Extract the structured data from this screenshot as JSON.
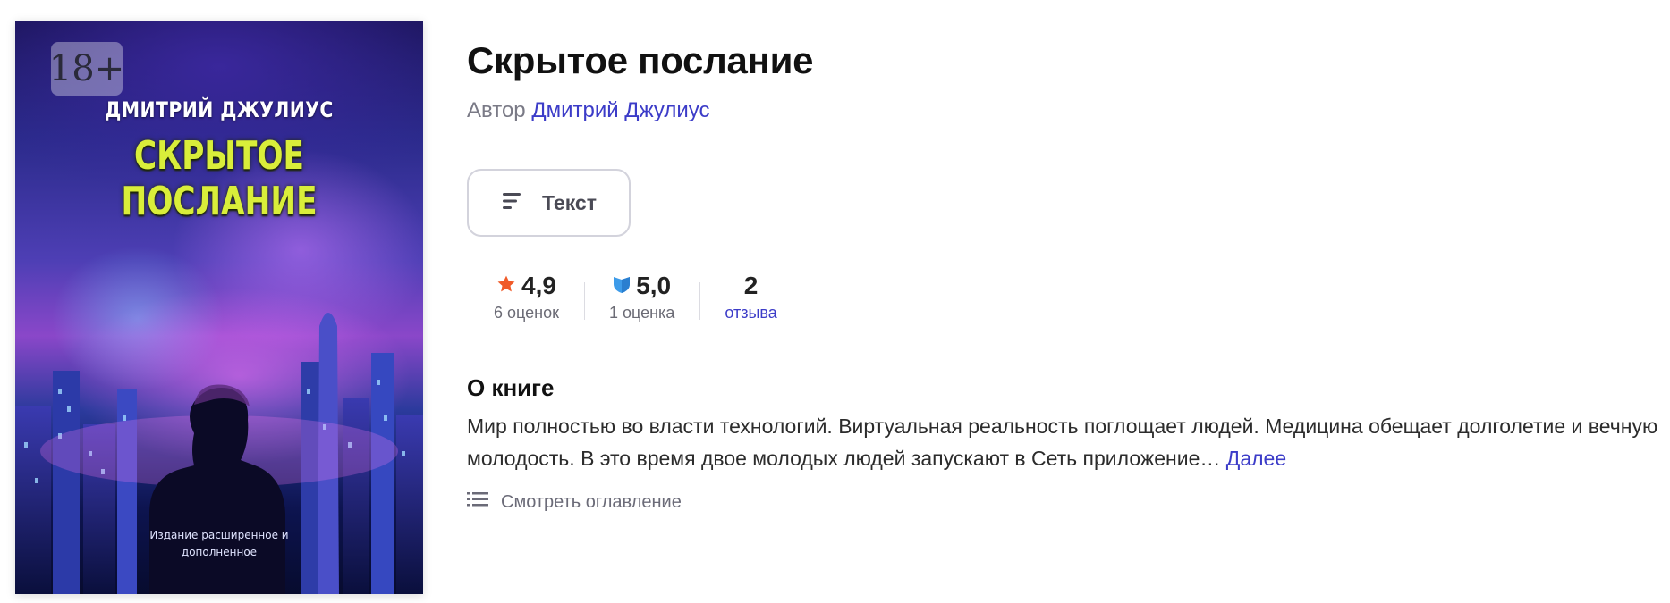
{
  "cover": {
    "age_badge": "18+",
    "author": "ДМИТРИЙ ДЖУЛИУС",
    "title": "СКРЫТОЕ ПОСЛАНИЕ",
    "edition_line1": "Издание расширенное и",
    "edition_line2": "дополненное"
  },
  "book": {
    "title": "Скрытое послание",
    "author_prefix": "Автор",
    "author_name": "Дмитрий Джулиус"
  },
  "format_button": {
    "label": "Текст",
    "icon": "text-lines-icon"
  },
  "ratings": [
    {
      "icon": "star-icon",
      "icon_color": "#f05a28",
      "value": "4,9",
      "sub": "6 оценок"
    },
    {
      "icon": "shield-icon",
      "icon_color": "#3d9be9",
      "value": "5,0",
      "sub": "1 оценка"
    },
    {
      "value": "2",
      "sub": "отзыва"
    }
  ],
  "about": {
    "title": "О книге",
    "text": "Мир полностью во власти технологий. Виртуальная реальность поглощает людей. Медицина обещает долголетие и вечную молодость. В это время двое молодых людей запускают в Сеть приложение…",
    "more": "Далее"
  },
  "toc": {
    "label": "Смотреть оглавление",
    "icon": "list-icon"
  },
  "colors": {
    "link": "#3c3cc8",
    "cover_title": "#d9ee3a"
  }
}
